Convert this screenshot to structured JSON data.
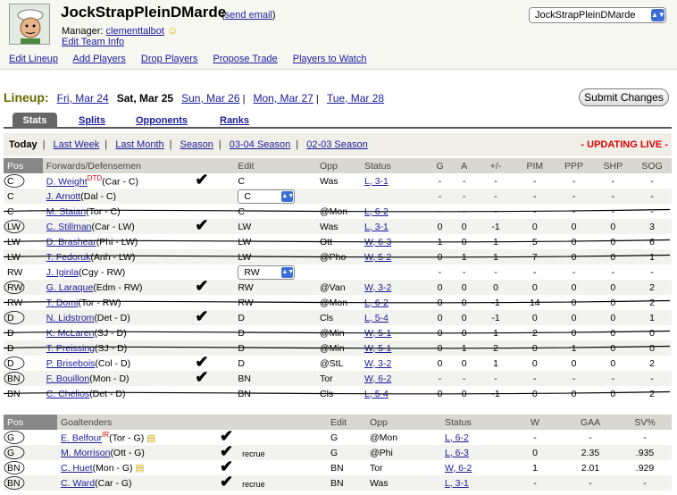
{
  "header": {
    "team_name": "JockStrapPleinDMarde",
    "send_email": "send email",
    "manager_label": "Manager:",
    "manager_name": "clementtalbot",
    "edit_team": "Edit Team Info",
    "team_select_value": "JockStrapPleinDMarde"
  },
  "nav": [
    "Edit Lineup",
    "Add Players",
    "Drop Players",
    "Propose Trade",
    "Players to Watch"
  ],
  "lineup": {
    "label": "Lineup:",
    "days": [
      "Fri, Mar 24",
      "Sat, Mar 25",
      "Sun, Mar 26",
      "Mon, Mar 27",
      "Tue, Mar 28"
    ],
    "submit": "Submit Changes"
  },
  "tabs": [
    "Stats",
    "Splits",
    "Opponents",
    "Ranks"
  ],
  "subtabs": {
    "items": [
      "Today",
      "Last Week",
      "Last Month",
      "Season",
      "03-04 Season",
      "02-03 Season"
    ],
    "updating": "- UPDATING LIVE -"
  },
  "skaters": {
    "headers": [
      "Pos",
      "Forwards/Defensemen",
      "Edit",
      "Opp",
      "Status",
      "G",
      "A",
      "+/-",
      "PIM",
      "PPP",
      "SHP",
      "SOG"
    ],
    "rows": [
      {
        "pos": "C",
        "name": "D. Weight",
        "badge": "DTD",
        "team": "(Car - C)",
        "check": true,
        "edit": "C",
        "opp": "Was",
        "status": "L, 3-1",
        "g": "-",
        "a": "-",
        "pm": "-",
        "pim": "-",
        "ppp": "-",
        "shp": "-",
        "sog": "-"
      },
      {
        "pos": "C",
        "name": "J. Arnott",
        "badge": "",
        "team": "(Dal - C)",
        "check": false,
        "edit": "C",
        "edit_select": true,
        "opp": "",
        "status": "",
        "g": "-",
        "a": "-",
        "pm": "-",
        "pim": "-",
        "ppp": "-",
        "shp": "-",
        "sog": "-"
      },
      {
        "pos": "C",
        "name": "M. Staian",
        "badge": "",
        "team": "(Tor - C)",
        "check": false,
        "edit": "C",
        "opp": "@Mon",
        "status": "L, 6-2",
        "g": "-",
        "a": "-",
        "pm": "-",
        "pim": "-",
        "ppp": "-",
        "shp": "-",
        "sog": "-"
      },
      {
        "pos": "LW",
        "name": "C. Stillman",
        "badge": "",
        "team": "(Car - LW)",
        "check": true,
        "edit": "LW",
        "opp": "Was",
        "status": "L, 3-1",
        "g": "0",
        "a": "0",
        "pm": "-1",
        "pim": "0",
        "ppp": "0",
        "shp": "0",
        "sog": "3"
      },
      {
        "pos": "LW",
        "name": "D. Brashear",
        "badge": "",
        "team": "(Phi - LW)",
        "check": false,
        "edit": "LW",
        "opp": "Ott",
        "status": "W, 6-3",
        "g": "1",
        "a": "0",
        "pm": "1",
        "pim": "5",
        "ppp": "0",
        "shp": "0",
        "sog": "6"
      },
      {
        "pos": "LW",
        "name": "T. Fedoruk",
        "badge": "",
        "team": "(Anh - LW)",
        "check": false,
        "edit": "LW",
        "opp": "@Pho",
        "status": "W, 5-2",
        "g": "0",
        "a": "1",
        "pm": "1",
        "pim": "7",
        "ppp": "0",
        "shp": "0",
        "sog": "1"
      },
      {
        "pos": "RW",
        "name": "J. Iginla",
        "badge": "",
        "team": "(Cgy - RW)",
        "check": false,
        "edit": "RW",
        "edit_select": true,
        "opp": "",
        "status": "",
        "g": "-",
        "a": "-",
        "pm": "-",
        "pim": "-",
        "ppp": "-",
        "shp": "-",
        "sog": "-"
      },
      {
        "pos": "RW",
        "name": "G. Laraque",
        "badge": "",
        "team": "(Edm - RW)",
        "check": true,
        "edit": "RW",
        "opp": "@Van",
        "status": "W, 3-2",
        "g": "0",
        "a": "0",
        "pm": "0",
        "pim": "0",
        "ppp": "0",
        "shp": "0",
        "sog": "2"
      },
      {
        "pos": "RW",
        "name": "T. Domi",
        "badge": "",
        "team": "(Tor - RW)",
        "check": false,
        "edit": "RW",
        "opp": "@Mon",
        "status": "L, 6-2",
        "g": "0",
        "a": "0",
        "pm": "-1",
        "pim": "14",
        "ppp": "0",
        "shp": "0",
        "sog": "2"
      },
      {
        "pos": "D",
        "name": "N. Lidstrom",
        "badge": "",
        "team": "(Det - D)",
        "check": true,
        "edit": "D",
        "opp": "Cls",
        "status": "L, 5-4",
        "g": "0",
        "a": "0",
        "pm": "-1",
        "pim": "0",
        "ppp": "0",
        "shp": "0",
        "sog": "1"
      },
      {
        "pos": "D",
        "name": "K. McLaren",
        "badge": "",
        "team": "(SJ - D)",
        "check": false,
        "edit": "D",
        "opp": "@Min",
        "status": "W, 5-1",
        "g": "0",
        "a": "0",
        "pm": "1",
        "pim": "2",
        "ppp": "0",
        "shp": "0",
        "sog": "0"
      },
      {
        "pos": "D",
        "name": "T. Preissing",
        "badge": "",
        "team": "(SJ - D)",
        "check": false,
        "edit": "D",
        "opp": "@Min",
        "status": "W, 5-1",
        "g": "0",
        "a": "1",
        "pm": "2",
        "pim": "0",
        "ppp": "1",
        "shp": "0",
        "sog": "0"
      },
      {
        "pos": "D",
        "name": "P. Brisebois",
        "badge": "",
        "team": "(Col - D)",
        "check": true,
        "edit": "D",
        "opp": "@StL",
        "status": "W, 3-2",
        "g": "0",
        "a": "0",
        "pm": "1",
        "pim": "0",
        "ppp": "0",
        "shp": "0",
        "sog": "2"
      },
      {
        "pos": "BN",
        "name": "F. Bouillon",
        "badge": "",
        "team": "(Mon - D)",
        "check": true,
        "edit": "BN",
        "opp": "Tor",
        "status": "W, 6-2",
        "g": "-",
        "a": "-",
        "pm": "-",
        "pim": "-",
        "ppp": "-",
        "shp": "-",
        "sog": "-"
      },
      {
        "pos": "BN",
        "name": "C. Chelios",
        "badge": "",
        "team": "(Det - D)",
        "check": false,
        "edit": "BN",
        "opp": "Cls",
        "status": "L, 5-4",
        "g": "0",
        "a": "0",
        "pm": "-1",
        "pim": "0",
        "ppp": "0",
        "shp": "0",
        "sog": "2"
      }
    ]
  },
  "goalies": {
    "headers": [
      "Pos",
      "Goaltenders",
      "Edit",
      "Opp",
      "Status",
      "W",
      "GAA",
      "SV%"
    ],
    "rows": [
      {
        "pos": "G",
        "name": "E. Belfour",
        "badge": "IR",
        "team": "(Tor - G)",
        "note_icon": true,
        "check": true,
        "note": "",
        "edit": "G",
        "opp": "@Mon",
        "status": "L, 6-2",
        "w": "-",
        "gaa": "-",
        "sv": "-"
      },
      {
        "pos": "G",
        "name": "M. Morrison",
        "badge": "",
        "team": "(Ott - G)",
        "note_icon": false,
        "check": true,
        "note": "recrue",
        "edit": "G",
        "opp": "@Phi",
        "status": "L, 6-3",
        "w": "0",
        "gaa": "2.35",
        "sv": ".935"
      },
      {
        "pos": "BN",
        "name": "C. Huet",
        "badge": "",
        "team": "(Mon - G)",
        "note_icon": true,
        "check": true,
        "note": "",
        "edit": "BN",
        "opp": "Tor",
        "status": "W, 6-2",
        "w": "1",
        "gaa": "2.01",
        "sv": ".929"
      },
      {
        "pos": "BN",
        "name": "C. Ward",
        "badge": "",
        "team": "(Car - G)",
        "note_icon": false,
        "check": true,
        "note": "recrue",
        "edit": "BN",
        "opp": "Was",
        "status": "L, 3-1",
        "w": "-",
        "gaa": "-",
        "sv": "-"
      }
    ]
  }
}
